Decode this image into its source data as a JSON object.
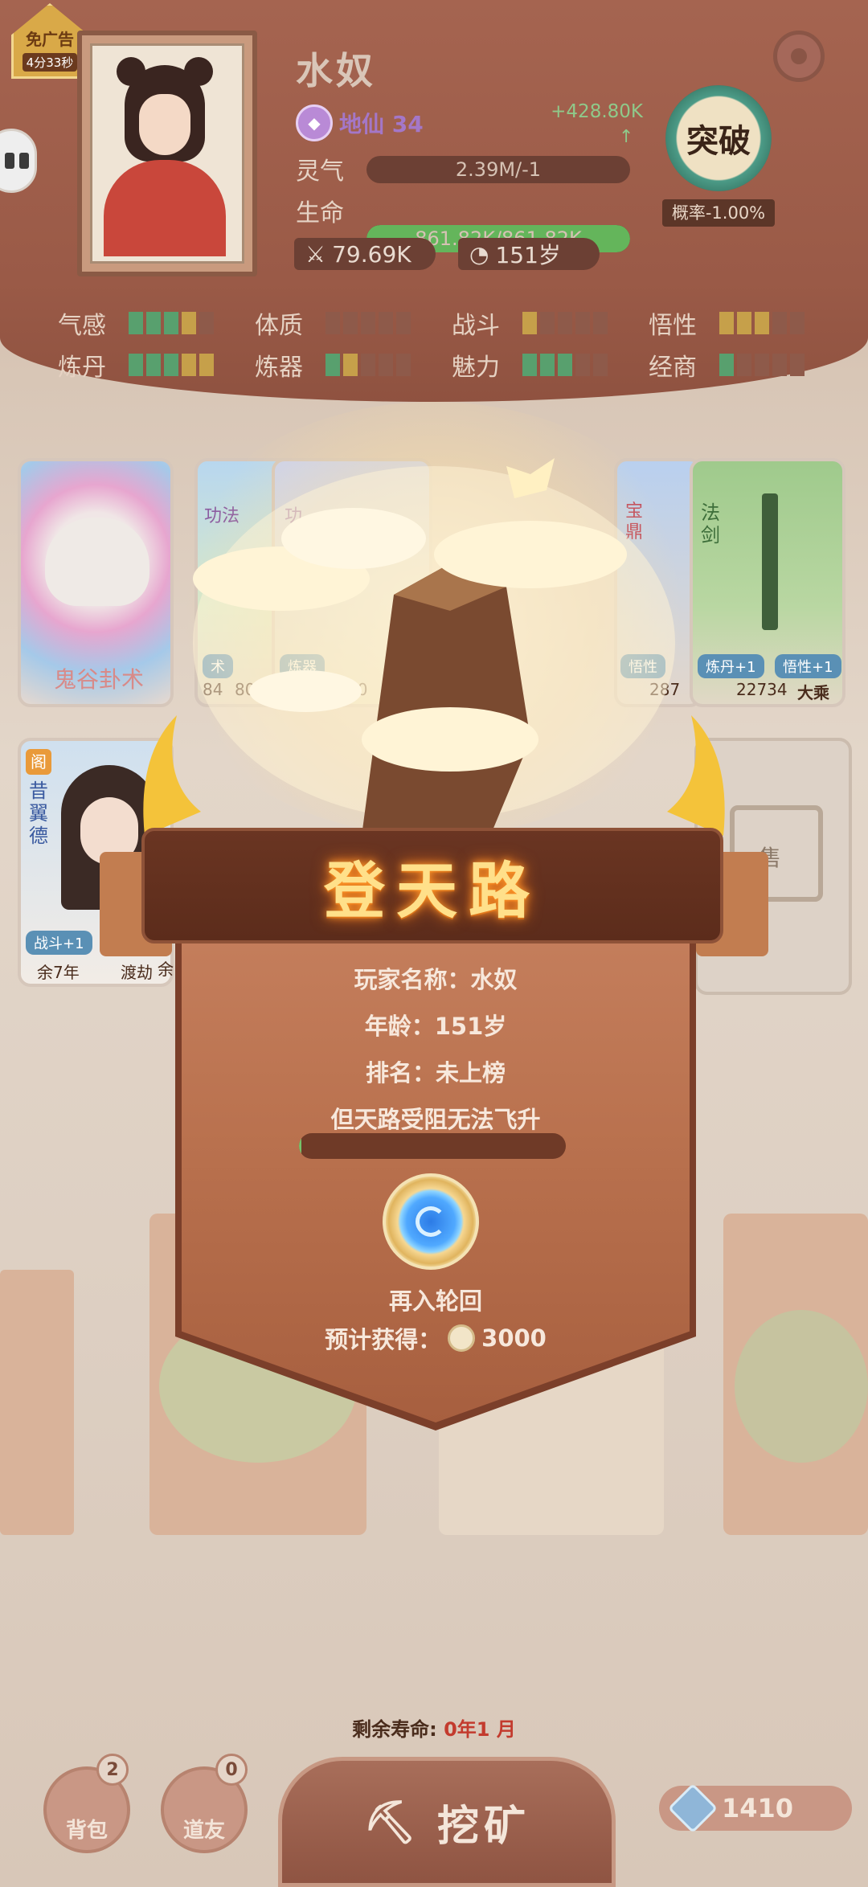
{
  "ad": {
    "label": "免广告",
    "timer": "4分33秒"
  },
  "player": {
    "name": "水奴",
    "realm": "地仙 34",
    "gain": "+428.80K",
    "gain_arrow": "↑",
    "qi_label": "灵气",
    "qi_value": "2.39M/-1",
    "life_label": "生命",
    "life_value": "861.82K/861.82K",
    "life_fraction": 1.0,
    "power": "79.69K",
    "age": "151岁"
  },
  "breakthrough": {
    "label": "突破",
    "probability": "概率-1.00%"
  },
  "attributes": [
    {
      "name": "气感",
      "segments": [
        "g",
        "g",
        "g",
        "y",
        "n"
      ]
    },
    {
      "name": "体质",
      "segments": [
        "n",
        "n",
        "n",
        "n",
        "n"
      ]
    },
    {
      "name": "战斗",
      "segments": [
        "y",
        "n",
        "n",
        "n",
        "n"
      ]
    },
    {
      "name": "悟性",
      "segments": [
        "y",
        "y",
        "y",
        "n",
        "n"
      ]
    },
    {
      "name": "炼丹",
      "segments": [
        "g",
        "g",
        "g",
        "y",
        "y"
      ]
    },
    {
      "name": "炼器",
      "segments": [
        "g",
        "y",
        "n",
        "n",
        "n"
      ]
    },
    {
      "name": "魅力",
      "segments": [
        "g",
        "g",
        "g",
        "n",
        "n"
      ]
    },
    {
      "name": "经商",
      "segments": [
        "g",
        "n",
        "n",
        "n",
        "n"
      ]
    }
  ],
  "cards": {
    "guigu": {
      "title": "鬼谷卦术"
    },
    "gongfa1": {
      "type": "功法",
      "tag": "术",
      "stats": [
        "84",
        "80"
      ]
    },
    "gongfa2": {
      "type": "功",
      "tag": "炼器",
      "stats": [
        "70",
        "60"
      ]
    },
    "baoding": {
      "type": "宝鼎",
      "tag": "悟性",
      "power": "287"
    },
    "fajian": {
      "type": "法剑",
      "tag1": "炼丹+1",
      "tag2": "悟性+1",
      "power": "22734",
      "rank": "大乘"
    },
    "npc1": {
      "badge": "阁",
      "name": "昔翼德",
      "tag": "战斗+1",
      "remain": "余7年",
      "status": "渡劫",
      "remain2": "余1"
    },
    "shop": {
      "label": "售"
    }
  },
  "modal": {
    "title": "登天路",
    "player_name_line": "玩家名称：水奴",
    "age_line": "年龄：151岁",
    "rank_line": "排名：未上榜",
    "status_line": "但天路受阻无法飞升",
    "progress": 0.01,
    "action_label": "再入轮回",
    "reward_label": "预计获得：",
    "reward_value": "3000"
  },
  "bottom": {
    "lifespan_label": "剩余寿命:",
    "lifespan_value": "0年1 月",
    "bag_label": "背包",
    "bag_count": "2",
    "friend_label": "道友",
    "friend_count": "0",
    "mine_label": "挖矿",
    "gems": "1410"
  },
  "colors": {
    "header": "#9a5a47",
    "accent_gold": "#ffe08a",
    "life_green": "#64b55b"
  }
}
